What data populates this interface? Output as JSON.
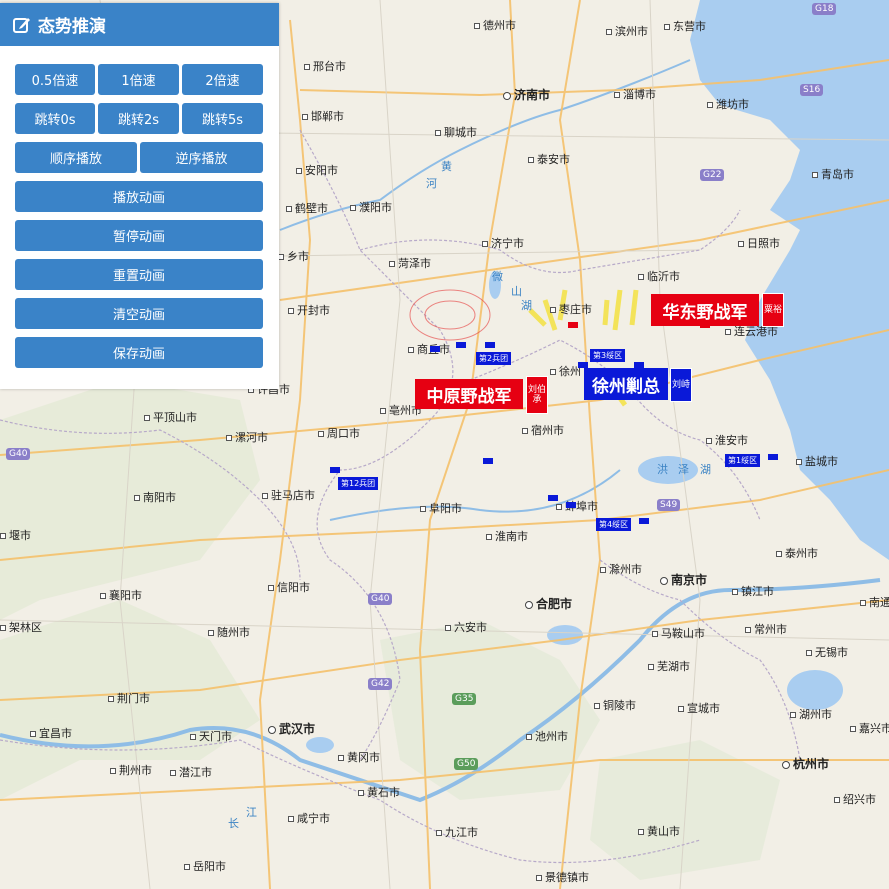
{
  "panel": {
    "title": "态势推演",
    "title_icon": "edit-icon",
    "speed_buttons": [
      "0.5倍速",
      "1倍速",
      "2倍速"
    ],
    "jump_buttons": [
      "跳转0s",
      "跳转2s",
      "跳转5s"
    ],
    "order_buttons": [
      "顺序播放",
      "逆序播放"
    ],
    "actions": [
      "播放动画",
      "暂停动画",
      "重置动画",
      "清空动画",
      "保存动画"
    ]
  },
  "cities": {
    "dezhou": "德州市",
    "binzhou": "滨州市",
    "dongying": "东营市",
    "xingtai": "邢台市",
    "jinan": "济南市",
    "zibo": "淄博市",
    "weifang": "潍坊市",
    "handan": "邯郸市",
    "liaocheng": "聊城市",
    "taian": "泰安市",
    "anyang": "安阳市",
    "qingdao": "青岛市",
    "hebi": "鹤壁市",
    "puyang": "濮阳市",
    "jining": "济宁市",
    "rizhao": "日照市",
    "xinxiang": "乡市",
    "heze": "菏泽市",
    "linyi": "临沂市",
    "kaifeng": "开封市",
    "zaozhuang": "枣庄市",
    "lianyungang": "连云港市",
    "shangqiu": "商丘市",
    "xuzhou": "徐州",
    "xuchang": "许昌市",
    "bozhou": "亳州市",
    "suzhou": "宿州市",
    "pingdingshan": "平顶山市",
    "luohe": "漯河市",
    "zhoukou": "周口市",
    "huaian": "淮安市",
    "yancheng": "盐城市",
    "nanyang": "南阳市",
    "zhumadian": "驻马店市",
    "bengbu": "蚌埠市",
    "fuyang": "阜阳市",
    "huainan": "淮南市",
    "taizhou": "泰州市",
    "chuzhou": "滁州市",
    "yan": "堰市",
    "xiangyang": "襄阳市",
    "xinyang": "信阳市",
    "nanjing": "南京市",
    "zhenjiang": "镇江市",
    "nantong": "南通",
    "hefei": "合肥市",
    "liuan": "六安市",
    "maanshan": "马鞍山市",
    "changzhou": "常州市",
    "jialinqu": "架林区",
    "suizhou": "随州市",
    "wuxi": "无锡市",
    "wuhu": "芜湖市",
    "jingmen": "荆门市",
    "tongling": "铜陵市",
    "xuancheng": "宣城市",
    "huzhou": "湖州市",
    "jiaxing": "嘉兴市",
    "yichang": "宜昌市",
    "tianmen": "天门市",
    "wuhan": "武汉市",
    "chizhou": "池州市",
    "jingzhou": "荆州市",
    "qianjiang": "潜江市",
    "huanggang": "黄冈市",
    "hangzhou": "杭州市",
    "huangshi": "黄石市",
    "shaoxing": "绍兴市",
    "xianning": "咸宁市",
    "jiujiang": "九江市",
    "huangshan": "黄山市",
    "yueyang": "岳阳市",
    "jingdezhen": "景德镇市"
  },
  "highways": [
    "G18",
    "S16",
    "G22",
    "G40",
    "S49",
    "G40",
    "G42",
    "G35",
    "G50"
  ],
  "water_labels": [
    "黄",
    "河",
    "微",
    "山",
    "湖",
    "洪",
    "泽",
    "湖",
    "长",
    "江"
  ],
  "armies": {
    "east": {
      "name": "华东野战军",
      "tag": "粟裕",
      "color": "#e60012"
    },
    "central": {
      "name": "中原野战军",
      "tag": "刘伯承",
      "color": "#e60012"
    },
    "enemy": {
      "name": "徐州剿总",
      "tag": "刘峙",
      "color": "#0a19d8"
    }
  },
  "units": [
    "第3绥区",
    "第1绥区",
    "第4绥区",
    "第2兵团",
    "第12兵团"
  ]
}
